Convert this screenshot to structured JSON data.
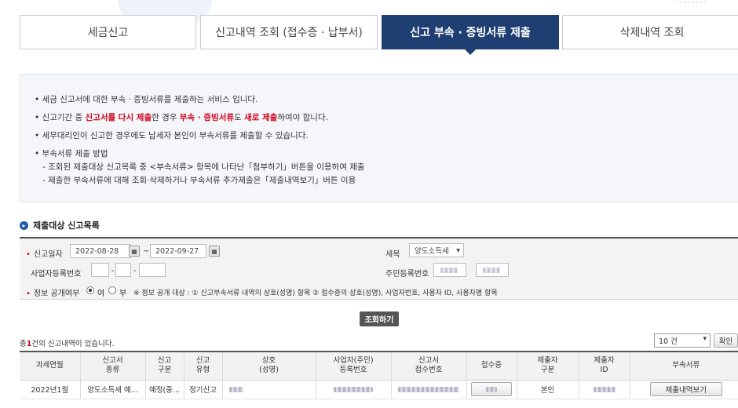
{
  "tabs": [
    {
      "label": "세금신고"
    },
    {
      "label": "신고내역 조회 (접수증 · 납부서)"
    },
    {
      "label": "신고 부속 · 증빙서류 제출"
    },
    {
      "label": "삭제내역 조회"
    }
  ],
  "info": {
    "line1": "• 세금 신고서에 대한 부속 · 증빙서류를 제출하는 서비스 입니다.",
    "line2_a": "• 신고기간 중 ",
    "line2_b": "신고서를 다시 제출",
    "line2_c": "한 경우 ",
    "line2_d": "부속 · 증빙서류",
    "line2_e": "도 ",
    "line2_f": "새로 제출",
    "line2_g": "하여야 합니다.",
    "line3": "• 세무대리인이 신고한 경우에도 납세자 본인이 부속서류를 제출할 수 있습니다.",
    "line4": "• 부속서류 제출 방법",
    "line5": "- 조회된 제출대상 신고목록 중 <부속서류> 항목에 나타난「첨부하기」버튼을 이용하여 제출",
    "line6": "- 제출한 부속서류에 대해 조회·삭제하거나 부속서류 추가제출은「제출내역보기」버튼 이용"
  },
  "section_title": "제출대상 신고목록",
  "search": {
    "date_label": "신고일자",
    "date_from": "2022-08-28",
    "date_to": "2022-09-27",
    "tilde": "~",
    "tax_label": "세목",
    "tax_value": "양도소득세",
    "biz_label": "사업자등록번호",
    "dash": "-",
    "rrn_label": "주민등록번호",
    "disclose_label": "정보 공개여부",
    "yes": "여",
    "no": "부",
    "disclose_note": "※ 정보 공개 대상 : ① 신고부속서류 내역의 상호(성명) 항목 ② 접수증의 상호(성명), 사업자번호, 사용자 ID, 사용자명 항목"
  },
  "search_button": "조회하기",
  "count": {
    "prefix": "총",
    "num": "1",
    "suffix": "건의 신고내역이 있습니다."
  },
  "page_size": "10 건",
  "confirm_button": "확인",
  "table": {
    "headers": [
      "과세연월",
      "신고서\n종류",
      "신고\n구분",
      "신고\n유형",
      "상호\n(성명)",
      "사업자(주민)\n등록번호",
      "신고서\n접수번호",
      "접수증",
      "제출자\n구분",
      "제출자\nID",
      "부속서류"
    ],
    "row": {
      "period": "2022년1월",
      "type": "양도소득세 예...",
      "division": "예정(중...",
      "kind": "정기신고",
      "submitter_type": "본인",
      "action": "제출내역보기"
    }
  }
}
